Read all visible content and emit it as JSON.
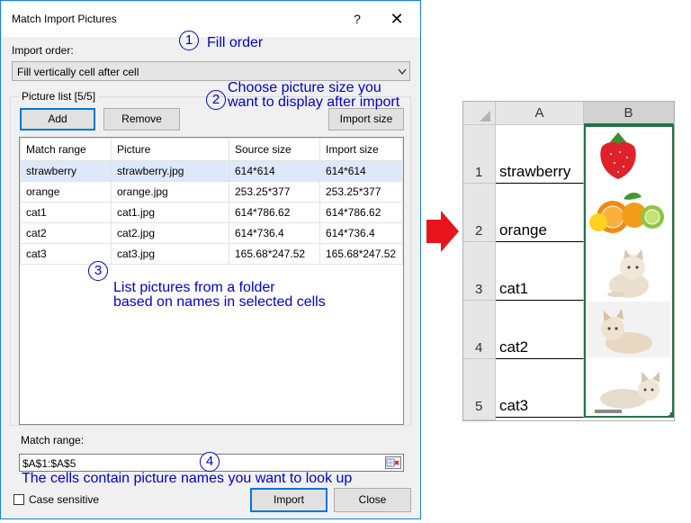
{
  "dialog": {
    "title": "Match Import Pictures",
    "help_label": "?",
    "close_label": "✕",
    "import_order_label": "Import order:",
    "import_order_value": "Fill vertically cell after cell",
    "picture_list_label": "Picture list [5/5]",
    "add_label": "Add",
    "remove_label": "Remove",
    "import_size_label": "Import size",
    "columns": [
      "Match range",
      "Picture",
      "Source size",
      "Import size"
    ],
    "rows": [
      [
        "strawberry",
        "strawberry.jpg",
        "614*614",
        "614*614"
      ],
      [
        "orange",
        "orange.jpg",
        "253.25*377",
        "253.25*377"
      ],
      [
        "cat1",
        "cat1.jpg",
        "614*786.62",
        "614*786.62"
      ],
      [
        "cat2",
        "cat2.jpg",
        "614*736.4",
        "614*736.4"
      ],
      [
        "cat3",
        "cat3.jpg",
        "165.68*247.52",
        "165.68*247.52"
      ]
    ],
    "match_range_label": "Match range:",
    "match_range_value": "$A$1:$A$5",
    "case_sensitive_label": "Case sensitive",
    "import_button": "Import",
    "close_button": "Close"
  },
  "callouts": {
    "c1_num": "1",
    "c1_text": "Fill order",
    "c2_num": "2",
    "c2_line1": "Choose picture size you",
    "c2_line2": "want to display after import",
    "c3_num": "3",
    "c3_line1": "List pictures from a folder",
    "c3_line2": "based on names in selected cells",
    "c4_num": "4",
    "c4_text": "The cells contain picture names you want to look up"
  },
  "excel": {
    "col_a": "A",
    "col_b": "B",
    "rows": [
      {
        "num": "1",
        "name": "strawberry"
      },
      {
        "num": "2",
        "name": "orange"
      },
      {
        "num": "3",
        "name": "cat1"
      },
      {
        "num": "4",
        "name": "cat2"
      },
      {
        "num": "5",
        "name": "cat3"
      }
    ]
  },
  "colors": {
    "accent": "#0078d7",
    "callout_blue": "#0000cc",
    "arrow_red": "#e8141c",
    "selection_green": "#217346"
  }
}
